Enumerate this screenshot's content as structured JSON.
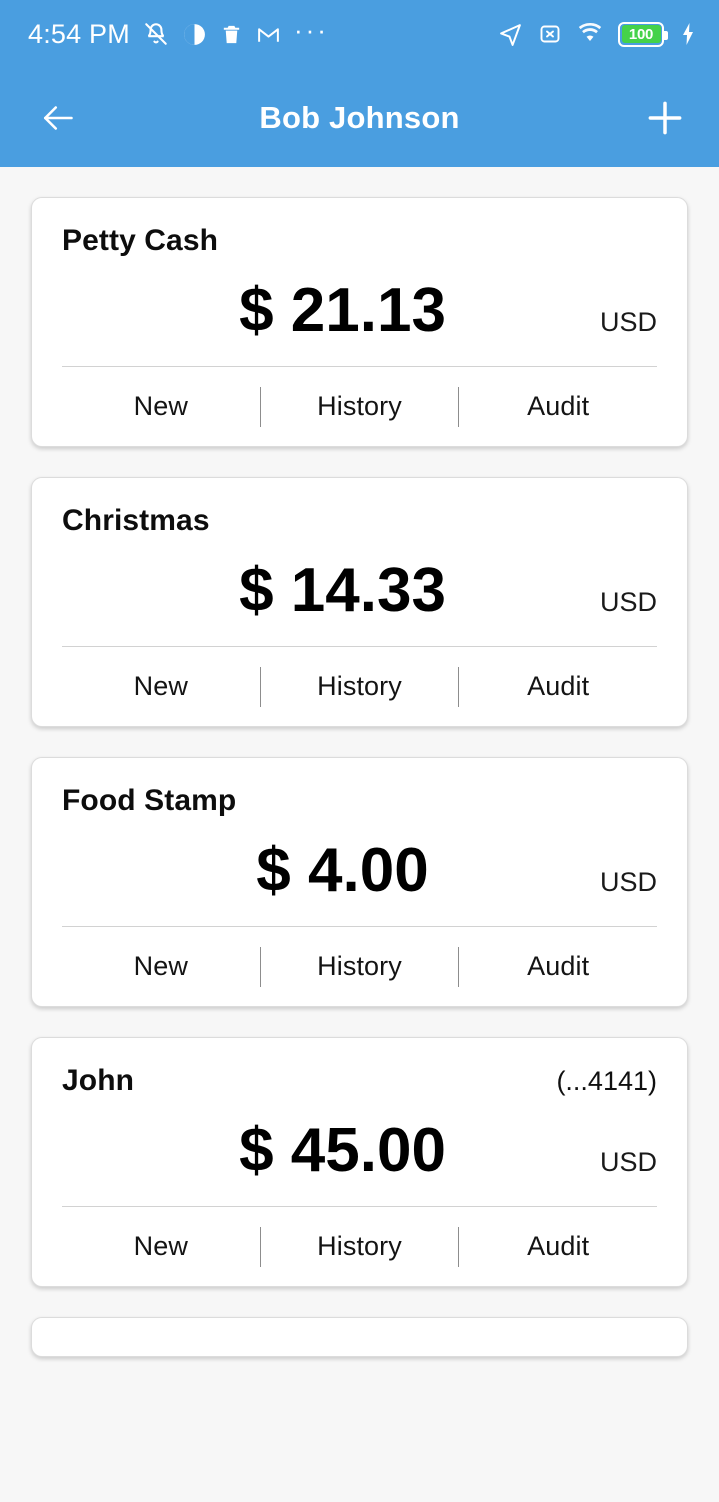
{
  "statusbar": {
    "time": "4:54 PM",
    "icons_left": [
      "bell-mute-icon",
      "half-circle-icon",
      "trash-icon",
      "gmail-icon",
      "more-dots-icon"
    ],
    "icons_right": [
      "location-arrow-icon",
      "no-sim-icon",
      "wifi-icon",
      "battery-icon",
      "charging-bolt-icon"
    ],
    "battery_level": "100",
    "battery_color": "#45d24a"
  },
  "appbar": {
    "back_label": "back-arrow",
    "title": "Bob Johnson",
    "add_label": "plus",
    "background": "#4a9ee0"
  },
  "actions": {
    "new": "New",
    "history": "History",
    "audit": "Audit"
  },
  "accounts": [
    {
      "title": "Petty Cash",
      "sub": "",
      "amount": "$ 21.13",
      "currency": "USD"
    },
    {
      "title": "Christmas",
      "sub": "",
      "amount": "$ 14.33",
      "currency": "USD"
    },
    {
      "title": "Food Stamp",
      "sub": "",
      "amount": "$ 4.00",
      "currency": "USD"
    },
    {
      "title": "John",
      "sub": "(...4141)",
      "amount": "$ 45.00",
      "currency": "USD"
    }
  ]
}
